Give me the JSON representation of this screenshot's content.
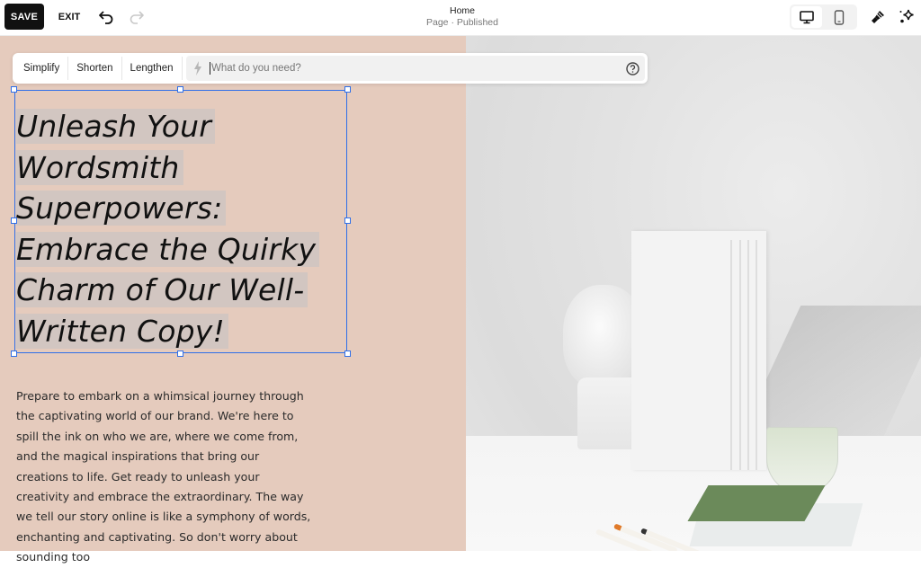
{
  "topbar": {
    "save_label": "SAVE",
    "exit_label": "EXIT",
    "page_title": "Home",
    "page_status": "Page · Published",
    "icons": {
      "undo": "undo-icon",
      "redo": "redo-icon",
      "desktop": "desktop-icon",
      "mobile": "mobile-icon",
      "design": "paintbrush-icon",
      "ai": "sparkle-icon"
    },
    "active_device": "desktop"
  },
  "ai_toolbar": {
    "actions": [
      "Simplify",
      "Shorten",
      "Lengthen"
    ],
    "input_value": "",
    "input_placeholder": "What do you need?",
    "icons": {
      "bolt": "lightning-icon",
      "help": "help-circle-icon"
    }
  },
  "content": {
    "heading_lines": [
      "Unleash Your",
      "Wordsmith",
      "Superpowers:",
      "Embrace the Quirky",
      "Charm of Our Well-",
      "Written Copy!"
    ],
    "body_text": "Prepare to embark on a whimsical journey through the captivating world of our brand. We're here to spill the ink on who we are, where we come from, and the magical inspirations that bring our creations to life. Get ready to unleash your creativity and embrace the extraordinary. The way we tell our story online is like a symphony of words, enchanting and captivating. So don't worry about sounding too",
    "image_description": "White bust sculpture, white books, green bowl and tray, pens on a white desk"
  },
  "colors": {
    "left_background": "#e5cbbd",
    "selection_blue": "#2f6fe8",
    "text_highlight": "#d2c6c1",
    "save_button": "#111111"
  }
}
